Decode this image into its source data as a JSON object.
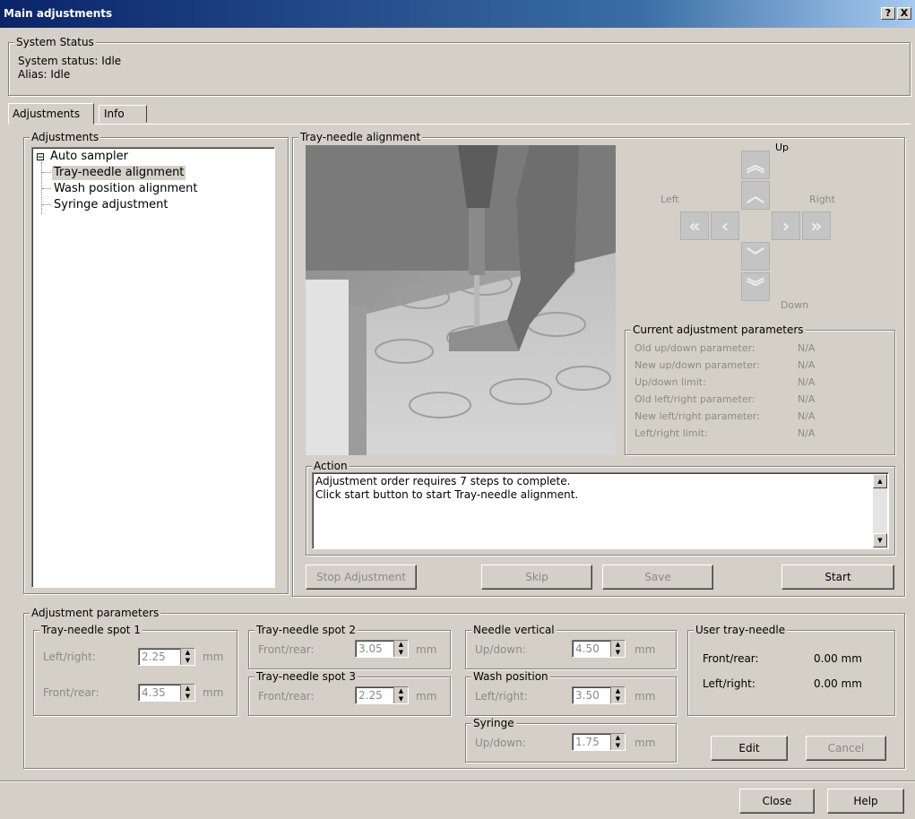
{
  "window": {
    "title": "Main adjustments",
    "help_btn": "?",
    "close_btn": "X"
  },
  "status": {
    "legend": "System Status",
    "system_status": "System status: Idle",
    "alias": "Alias: Idle"
  },
  "tabs": [
    {
      "label": "Adjustments"
    },
    {
      "label": "Info"
    }
  ],
  "adjustments_tree": {
    "legend": "Adjustments",
    "expander": "⊟",
    "root": "Auto sampler",
    "children": [
      {
        "label": "Tray-needle alignment"
      },
      {
        "label": "Wash position alignment"
      },
      {
        "label": "Syringe adjustment"
      }
    ]
  },
  "alignment": {
    "legend": "Tray-needle alignment",
    "labels": {
      "up": "Up",
      "down": "Down",
      "left": "Left",
      "right": "Right"
    },
    "arrows": {
      "up_fast": "︽",
      "up": "︿",
      "down": "﹀",
      "down_fast": "︾",
      "left_fast": "«",
      "left": "‹",
      "right": "›",
      "right_fast": "»"
    }
  },
  "current_params": {
    "legend": "Current adjustment parameters",
    "rows": [
      {
        "label": "Old up/down parameter:",
        "value": "N/A"
      },
      {
        "label": "New up/down parameter:",
        "value": "N/A"
      },
      {
        "label": "Up/down limit:",
        "value": "N/A"
      },
      {
        "label": "Old left/right parameter:",
        "value": "N/A"
      },
      {
        "label": "New left/right parameter:",
        "value": "N/A"
      },
      {
        "label": "Left/right limit:",
        "value": "N/A"
      }
    ]
  },
  "action": {
    "legend": "Action",
    "line1": "Adjustment order requires 7 steps to complete.",
    "line2": "Click start button to start Tray-needle alignment.",
    "scroll_up": "▲",
    "scroll_down": "▼"
  },
  "buttons": {
    "stop": "Stop Adjustment",
    "skip": "Skip",
    "save": "Save",
    "start": "Start",
    "edit": "Edit",
    "cancel": "Cancel",
    "close": "Close",
    "help": "Help"
  },
  "params": {
    "legend": "Adjustment parameters",
    "spot1": {
      "legend": "Tray-needle spot 1",
      "lr_label": "Left/right:",
      "lr_value": "2.25",
      "fr_label": "Front/rear:",
      "fr_value": "4.35"
    },
    "spot2": {
      "legend": "Tray-needle spot  2",
      "fr_label": "Front/rear:",
      "fr_value": "3.05"
    },
    "spot3": {
      "legend": "Tray-needle spot 3",
      "fr_label": "Front/rear:",
      "fr_value": "2.25"
    },
    "needle": {
      "legend": "Needle vertical",
      "ud_label": "Up/down:",
      "ud_value": "4.50"
    },
    "wash": {
      "legend": "Wash position",
      "lr_label": "Left/right:",
      "lr_value": "3.50"
    },
    "syringe": {
      "legend": "Syringe",
      "ud_label": "Up/down:",
      "ud_value": "1.75"
    },
    "user": {
      "legend": "User tray-needle",
      "fr_label": "Front/rear:",
      "fr_value": "0.00 mm",
      "lr_label": "Left/right:",
      "lr_value": "0.00 mm"
    },
    "unit": "mm"
  }
}
